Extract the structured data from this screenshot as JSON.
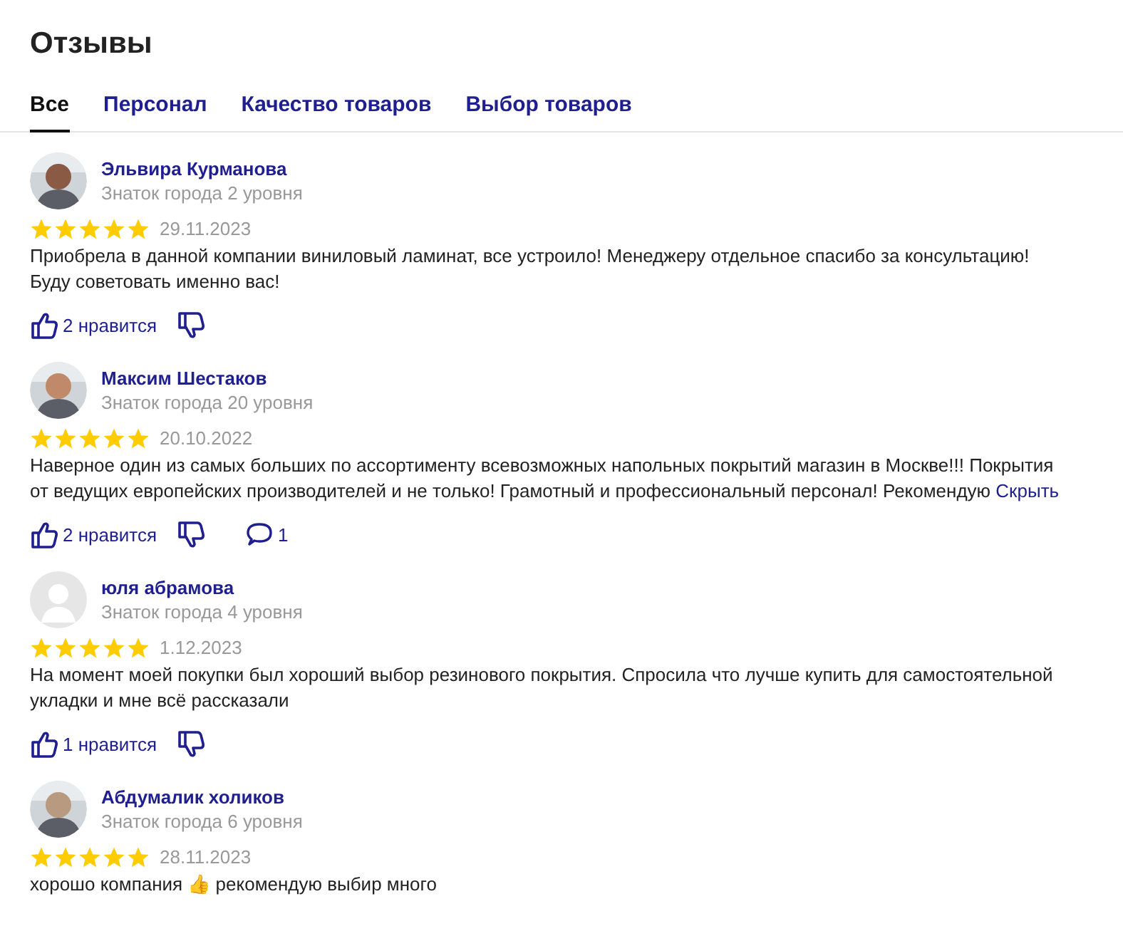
{
  "title": "Отзывы",
  "tabs": [
    {
      "label": "Все",
      "selected": true
    },
    {
      "label": "Персонал",
      "selected": false
    },
    {
      "label": "Качество товаров",
      "selected": false
    },
    {
      "label": "Выбор товаров",
      "selected": false
    }
  ],
  "reviews": [
    {
      "name": "Эльвира Курманова",
      "level": "Знаток города 2 уровня",
      "stars": 5,
      "date": "29.11.2023",
      "text": "Приобрела в данной компании виниловый ламинат, все устроило! Менеджеру отдельное спасибо за консультацию! Буду советовать именно вас!",
      "likes": "2 нравится"
    },
    {
      "name": "Максим Шестаков",
      "level": "Знаток города 20 уровня",
      "stars": 5,
      "date": "20.10.2022",
      "text": "Наверное один из самых больших по ассортименту всевозможных напольных покрытий магазин в Москве!!! Покрытия от ведущих европейских производителей и не только! Грамотный и профессиональный персонал! Рекомендую",
      "link": "Скрыть",
      "likes": "2 нравится",
      "comments": "1"
    },
    {
      "avatar": {
        "kind": "placeholder",
        "color": "#e6e6e6"
      },
      "name": "юля абрамова",
      "level": "Знаток города 4 уровня",
      "stars": 5,
      "date": "1.12.2023",
      "text": "На момент моей покупки был хороший выбор резинового покрытия. Спросила что лучше купить для самостоятельной укладки и мне всё рассказали",
      "likes": "1 нравится"
    },
    {
      "name": "Абдумалик холиков",
      "level": "Знаток города 6 уровня",
      "stars": 5,
      "date": "28.11.2023",
      "text": "хорошо компания 👍 рекомендую выбир много"
    }
  ]
}
